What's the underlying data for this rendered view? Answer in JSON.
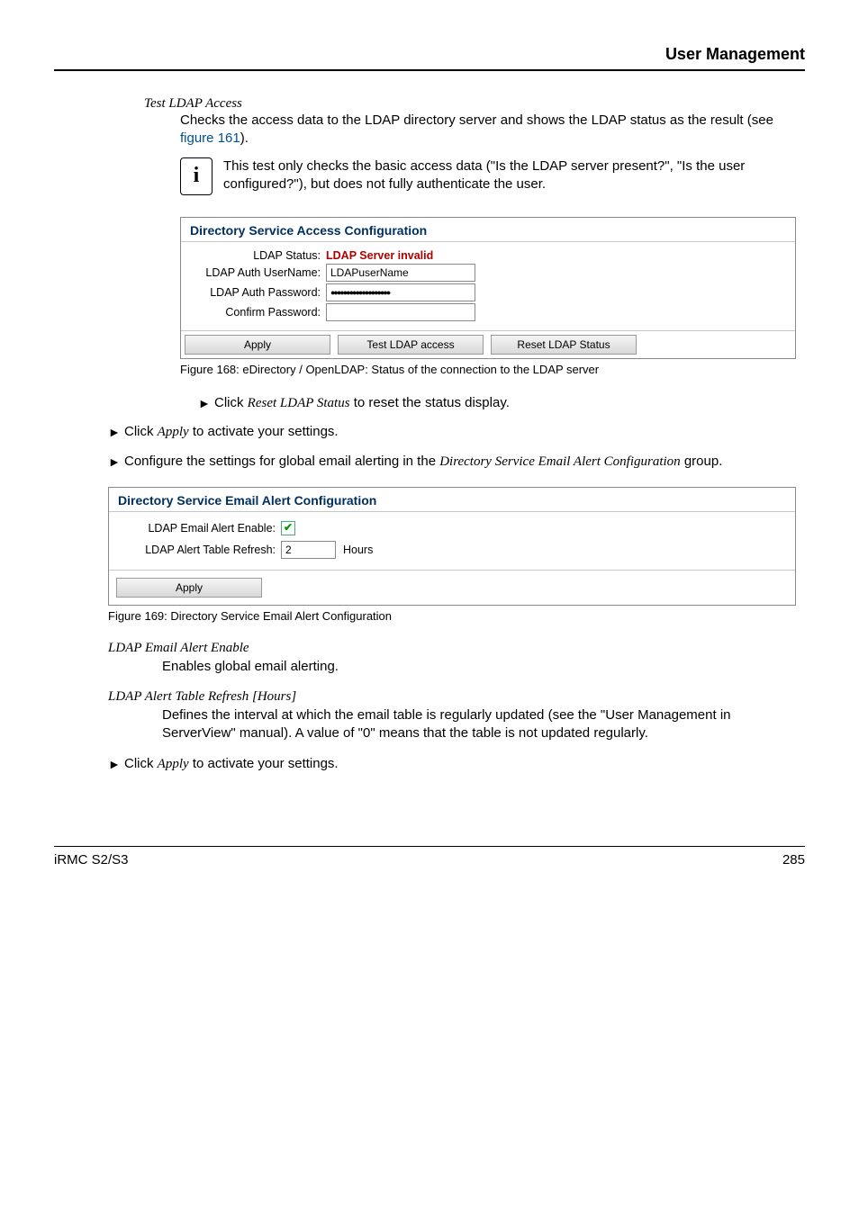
{
  "header": {
    "title": "User Management"
  },
  "sec1": {
    "term": "Test LDAP Access",
    "body1a": "Checks the access data to the LDAP directory server and shows the LDAP status as the result (see ",
    "body1link": "figure 161",
    "body1b": ").",
    "info": "This test only checks the basic access data (\"Is the LDAP server present?\", \"Is the user configured?\"), but does not fully authenticate the user."
  },
  "fig168": {
    "title": "Directory Service Access Configuration",
    "status_label": "LDAP Status:",
    "status_value": "LDAP Server invalid",
    "user_label": "LDAP Auth UserName:",
    "user_value": "LDAPuserName",
    "pass_label": "LDAP Auth Password:",
    "pass_value": "●●●●●●●●●●●●●●●●●●●",
    "confirm_label": "Confirm Password:",
    "btn_apply": "Apply",
    "btn_test": "Test LDAP access",
    "btn_reset": "Reset LDAP Status",
    "caption": "Figure 168:  eDirectory / OpenLDAP: Status of the connection to the LDAP server"
  },
  "list": {
    "clickreset_a": "Click ",
    "clickreset_i": "Reset LDAP Status",
    "clickreset_b": " to reset the status display.",
    "clickapply1_a": "Click ",
    "clickapply1_i": "Apply",
    "clickapply1_b": " to activate your settings.",
    "conf_a": "Configure the settings for global email alerting in the ",
    "conf_i": "Directory Service Email Alert Configuration",
    "conf_b": " group."
  },
  "fig169": {
    "title": "Directory Service Email Alert Configuration",
    "enable_label": "LDAP Email Alert Enable:",
    "refresh_label": "LDAP Alert Table Refresh:",
    "refresh_value": "2",
    "refresh_unit": "Hours",
    "btn_apply": "Apply",
    "caption": "Figure 169: Directory Service Email Alert Configuration"
  },
  "defs": {
    "d1_term": "LDAP Email Alert Enable",
    "d1_body": "Enables global email alerting.",
    "d2_term": "LDAP Alert Table Refresh [Hours]",
    "d2_body": "Defines the interval at which the email table is regularly updated (see the \"User Management in ServerView\" manual). A value of \"0\" means that the table is not updated regularly.",
    "final_a": "Click ",
    "final_i": "Apply",
    "final_b": " to activate your settings."
  },
  "footer": {
    "left": "iRMC S2/S3",
    "right": "285"
  },
  "glyph": {
    "i": "i",
    "arrow": "►",
    "check": "✔"
  }
}
